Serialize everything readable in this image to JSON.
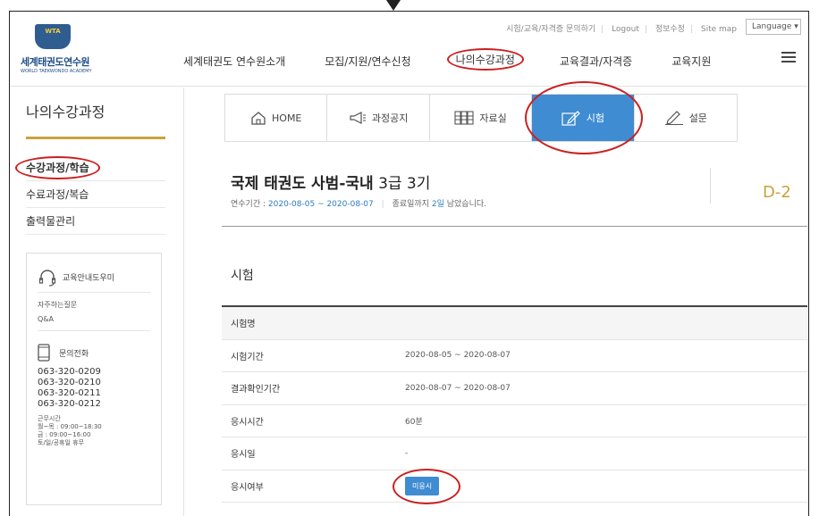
{
  "header": {
    "logo_top": "WTA",
    "logo_name": "세계태권도연수원",
    "logo_sub": "WORLD TAEKWONDO ACADEMY",
    "util_links": [
      "시험/교육/자격증 문의하기",
      "Logout",
      "정보수정",
      "Site map"
    ],
    "language": "Language ▾",
    "nav": [
      "세계태권도 연수원소개",
      "모집/지원/연수신청",
      "나의수강과정",
      "교육결과/자격증",
      "교육지원"
    ]
  },
  "sidebar": {
    "title": "나의수강과정",
    "menu": [
      "수강과정/학습",
      "수료과정/복습",
      "출력물관리"
    ],
    "help_title": "교육안내도우미",
    "faq": "자주하는질문",
    "qna": "Q&A",
    "phone_title": "문의전화",
    "phones": [
      "063-320-0209",
      "063-320-0210",
      "063-320-0211",
      "063-320-0212"
    ],
    "hours": [
      "근무시간",
      "월~목 : 09:00~18:30",
      "금 : 09:00~16:00",
      "토/일/공휴일 휴무"
    ]
  },
  "tabs": [
    "HOME",
    "과정공지",
    "자료실",
    "시험",
    "설문"
  ],
  "course": {
    "title_bold": "국제 태권도 사범-국내",
    "title_rest": "3급 3기",
    "period_label": "연수기간 :",
    "period": "2020-08-05 ~ 2020-08-07",
    "remaining_pre": "종료일까지",
    "remaining_days": "2일",
    "remaining_post": "남았습니다.",
    "dday": "D-2"
  },
  "exam": {
    "section_title": "시험",
    "rows": [
      {
        "label": "시험명",
        "value": ""
      },
      {
        "label": "시험기간",
        "value": "2020-08-05 ~ 2020-08-07"
      },
      {
        "label": "결과확인기간",
        "value": "2020-08-07 ~ 2020-08-07"
      },
      {
        "label": "응시시간",
        "value": "60분"
      },
      {
        "label": "응시일",
        "value": "-"
      },
      {
        "label": "응시여부",
        "button": "미응시"
      }
    ]
  },
  "colors": {
    "accent": "#3f8cd2",
    "gold": "#c9a23a",
    "highlight": "#cc1f1f"
  }
}
